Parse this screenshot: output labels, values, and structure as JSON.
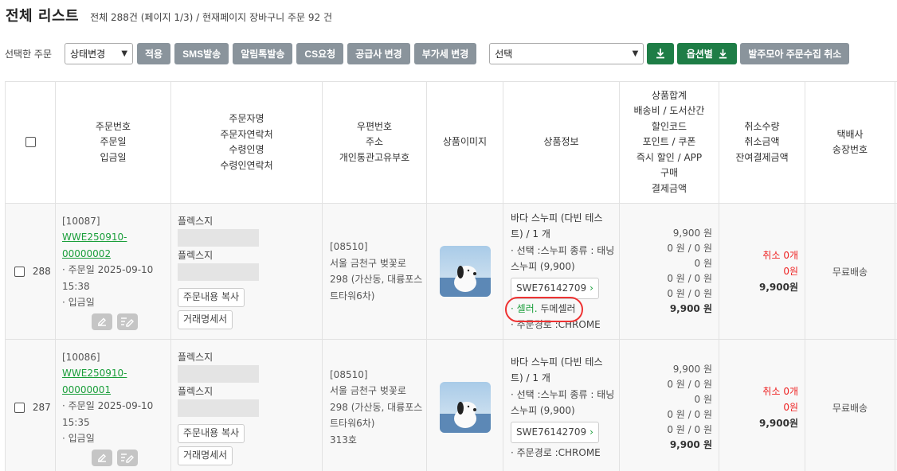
{
  "header": {
    "title": "전체 리스트",
    "summary": "전체 288건 (페이지 1/3) / 현재페이지 장바구니 주문 92 건"
  },
  "toolbar": {
    "selected_label": "선택한 주문",
    "status_select": "상태변경",
    "buttons": [
      "적용",
      "SMS발송",
      "알림톡발송",
      "CS요청",
      "공급사 변경",
      "부가세 변경"
    ],
    "option_select": "선택",
    "download_option_label": "옵션별",
    "cancel_collect_label": "발주모아 주문수집 취소"
  },
  "columns": {
    "order": [
      "주문번호",
      "주문일",
      "입금일"
    ],
    "orderer": [
      "주문자명",
      "주문자연락처",
      "수령인명",
      "수령인연락처"
    ],
    "address": [
      "우편번호",
      "주소",
      "개인통관고유부호"
    ],
    "image": "상품이미지",
    "product": "상품정보",
    "amount": [
      "상품합계",
      "배송비 / 도서산간",
      "할인코드",
      "포인트 / 쿠폰",
      "즉시 할인 / APP",
      "구매",
      "결제금액"
    ],
    "cancel": [
      "취소수량",
      "취소금액",
      "잔여결제금액"
    ],
    "ship": [
      "택배사",
      "송장번호"
    ]
  },
  "rows": [
    {
      "num": "288",
      "id": "[10087]",
      "order_no_1": "WWE250910-",
      "order_no_2": "00000002",
      "order_date_1": "· 주문일 2025-09-10",
      "order_date_2": "15:38",
      "paid": "· 입금일",
      "orderer": "플렉스지",
      "receiver": "플렉스지",
      "copy_btn": "주문내용 복사",
      "statement_btn": "거래명세서",
      "zip": "[08510]",
      "addr1": "서울 금천구 벚꽃로",
      "addr2": "298 (가산동, 대륭포스",
      "addr3": "트타워6차)",
      "addr4": "",
      "prod_name_1": "바다 스누피 (다빈 테스",
      "prod_name_2": "트) / 1 개",
      "prod_opt_1": "· 선택 :스누피 종류 : 태닝",
      "prod_opt_2": "스누피 (9,900)",
      "code": "SWE76142709",
      "seller_label": "· 셀러.",
      "seller_name": "두메셀러",
      "route": "· 주문경로 :CHROME",
      "amt": [
        "9,900 원",
        "0 원 / 0 원",
        "0 원",
        "0 원 / 0 원",
        "0 원 / 0 원",
        "0 원"
      ],
      "pay": "9,900 원",
      "cancel_qty": "취소 0개",
      "cancel_amt": "0원",
      "remain": "9,900원",
      "ship": "무료배송"
    },
    {
      "num": "287",
      "id": "[10086]",
      "order_no_1": "WWE250910-",
      "order_no_2": "00000001",
      "order_date_1": "· 주문일 2025-09-10",
      "order_date_2": "15:35",
      "paid": "· 입금일",
      "orderer": "플렉스지",
      "receiver": "플렉스지",
      "copy_btn": "주문내용 복사",
      "statement_btn": "거래명세서",
      "zip": "[08510]",
      "addr1": "서울 금천구 벚꽃로",
      "addr2": "298 (가산동, 대륭포스",
      "addr3": "트타워6차)",
      "addr4": "313호",
      "prod_name_1": "바다 스누피 (다빈 테스",
      "prod_name_2": "트) / 1 개",
      "prod_opt_1": "· 선택 :스누피 종류 : 태닝",
      "prod_opt_2": "스누피 (9,900)",
      "code": "SWE76142709",
      "route": "· 주문경로 :CHROME",
      "amt": [
        "9,900 원",
        "0 원 / 0 원",
        "0 원",
        "0 원 / 0 원",
        "0 원 / 0 원",
        "0 원"
      ],
      "pay": "9,900 원",
      "cancel_qty": "취소 0개",
      "cancel_amt": "0원",
      "remain": "9,900원",
      "ship": "무료배송"
    }
  ]
}
